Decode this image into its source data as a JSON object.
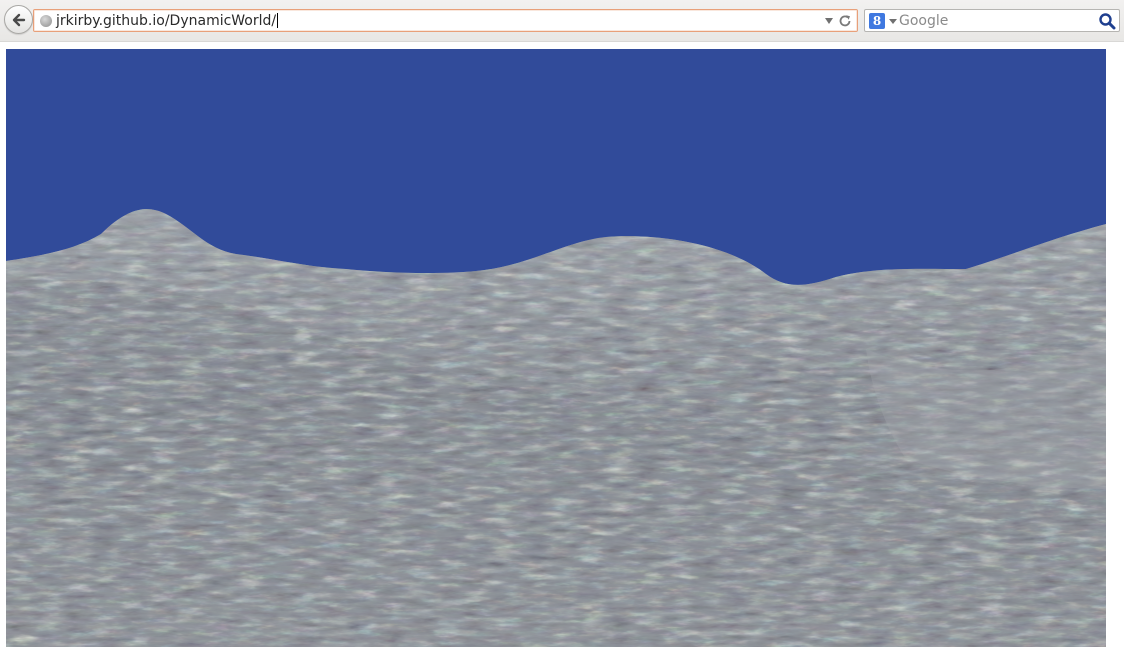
{
  "browser": {
    "url": "jrkirby.github.io/DynamicWorld/",
    "search": {
      "engine_letter": "8",
      "placeholder": "Google"
    }
  },
  "icons": {
    "back": "arrow-left-icon",
    "site": "globe-icon",
    "history": "chevron-down-icon",
    "reload": "reload-icon",
    "engine": "google-icon",
    "engine_dropdown": "chevron-down-icon",
    "search": "magnifier-icon"
  },
  "scene": {
    "sky_color": "#314b9a",
    "terrain_color": "#8f949a"
  }
}
